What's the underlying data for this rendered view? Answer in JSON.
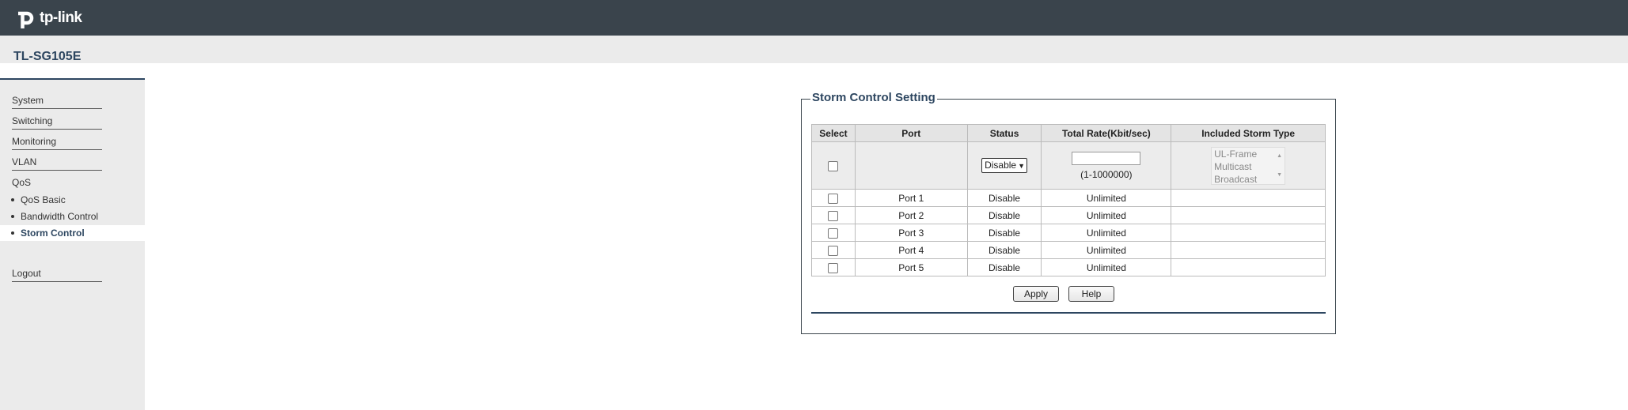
{
  "header": {
    "logo_text": "tp-link",
    "model": "TL-SG105E"
  },
  "sidebar": {
    "items": [
      {
        "label": "System"
      },
      {
        "label": "Switching"
      },
      {
        "label": "Monitoring"
      },
      {
        "label": "VLAN"
      },
      {
        "label": "QoS"
      }
    ],
    "qos_subitems": [
      {
        "label": "QoS Basic"
      },
      {
        "label": "Bandwidth Control"
      },
      {
        "label": "Storm Control",
        "active": true
      }
    ],
    "logout": "Logout"
  },
  "panel": {
    "title": "Storm Control Setting",
    "columns": [
      "Select",
      "Port",
      "Status",
      "Total Rate(Kbit/sec)",
      "Included Storm Type"
    ],
    "settings": {
      "status_value": "Disable",
      "rate_value": "",
      "rate_hint": "(1-1000000)",
      "storm_types": [
        "UL-Frame",
        "Multicast",
        "Broadcast"
      ]
    },
    "rows": [
      {
        "port": "Port 1",
        "status": "Disable",
        "rate": "Unlimited",
        "type": ""
      },
      {
        "port": "Port 2",
        "status": "Disable",
        "rate": "Unlimited",
        "type": ""
      },
      {
        "port": "Port 3",
        "status": "Disable",
        "rate": "Unlimited",
        "type": ""
      },
      {
        "port": "Port 4",
        "status": "Disable",
        "rate": "Unlimited",
        "type": ""
      },
      {
        "port": "Port 5",
        "status": "Disable",
        "rate": "Unlimited",
        "type": ""
      }
    ],
    "buttons": {
      "apply": "Apply",
      "help": "Help"
    }
  },
  "colors": {
    "topbar": "#3a444c",
    "accent": "#2d4660",
    "sidebar_bg": "#ebebeb"
  }
}
